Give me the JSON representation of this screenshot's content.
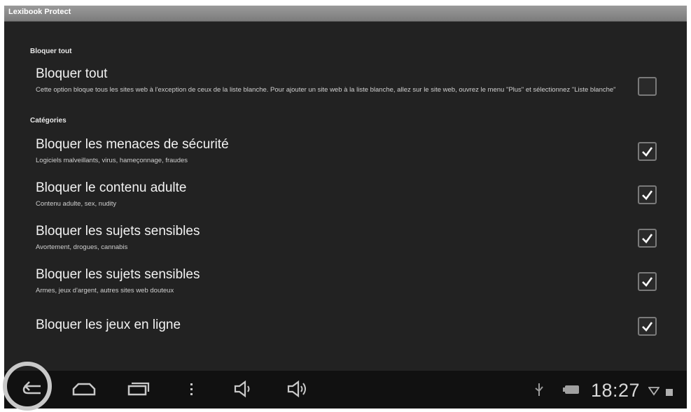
{
  "window": {
    "title": "Lexibook Protect"
  },
  "sections": {
    "bloquer_tout_header": "Bloquer tout",
    "categories_header": "Catégories"
  },
  "items": [
    {
      "title": "Bloquer tout",
      "summary": "Cette option bloque tous les sites web à l'exception de ceux de la liste blanche. Pour ajouter un site web à la liste blanche, allez sur le site web, ouvrez le menu \"Plus\" et sélectionnez \"Liste blanche\"",
      "checked": false
    },
    {
      "title": "Bloquer les menaces de sécurité",
      "summary": "Logiciels malveillants, virus, hameçonnage, fraudes",
      "checked": true
    },
    {
      "title": "Bloquer le contenu adulte",
      "summary": "Contenu adulte, sex, nudity",
      "checked": true
    },
    {
      "title": "Bloquer les sujets sensibles",
      "summary": "Avortement, drogues, cannabis",
      "checked": true
    },
    {
      "title": "Bloquer les sujets sensibles",
      "summary": "Armes, jeux d'argent, autres sites web douteux",
      "checked": true
    },
    {
      "title": "Bloquer les jeux en ligne",
      "summary": "",
      "checked": true
    }
  ],
  "navbar": {
    "icons": [
      "back-icon",
      "home-icon",
      "recent-apps-icon",
      "menu-icon",
      "volume-down-icon",
      "volume-up-icon"
    ],
    "status_icons": [
      "usb-icon",
      "battery-icon",
      "wifi-icon",
      "signal-icon"
    ],
    "time": "18:27"
  },
  "colors": {
    "background": "#222222",
    "titlebar": "#8a8a8a",
    "navbar": "#111111",
    "text": "#f2f2f2",
    "checkmark": "#ffffff"
  }
}
